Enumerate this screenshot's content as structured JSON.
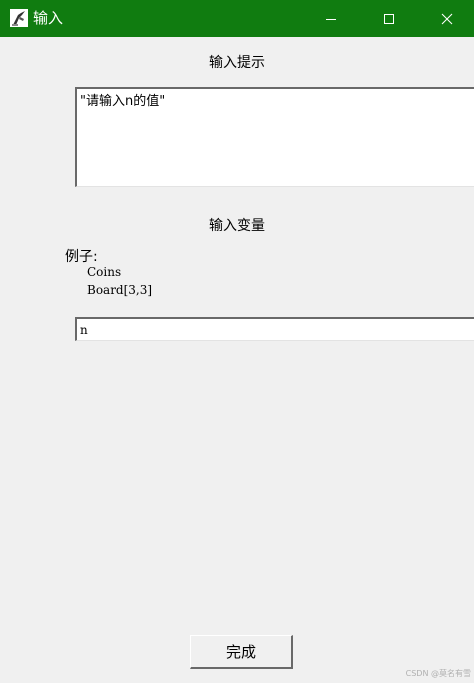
{
  "window": {
    "title": "输入",
    "controls": [
      "minimize-icon",
      "maximize-icon",
      "close-icon"
    ]
  },
  "prompt": {
    "label": "输入提示",
    "text": "\"请输入n的值\""
  },
  "variable": {
    "label": "输入变量",
    "example_title": "例子:",
    "examples": [
      "Coins",
      "Board[3,3]"
    ],
    "value": "n"
  },
  "actions": {
    "done_label": "完成"
  },
  "watermark": "CSDN @莫名有雪",
  "colors": {
    "titlebar": "#107c10",
    "background": "#f0f0f0",
    "field": "#ffffff"
  }
}
